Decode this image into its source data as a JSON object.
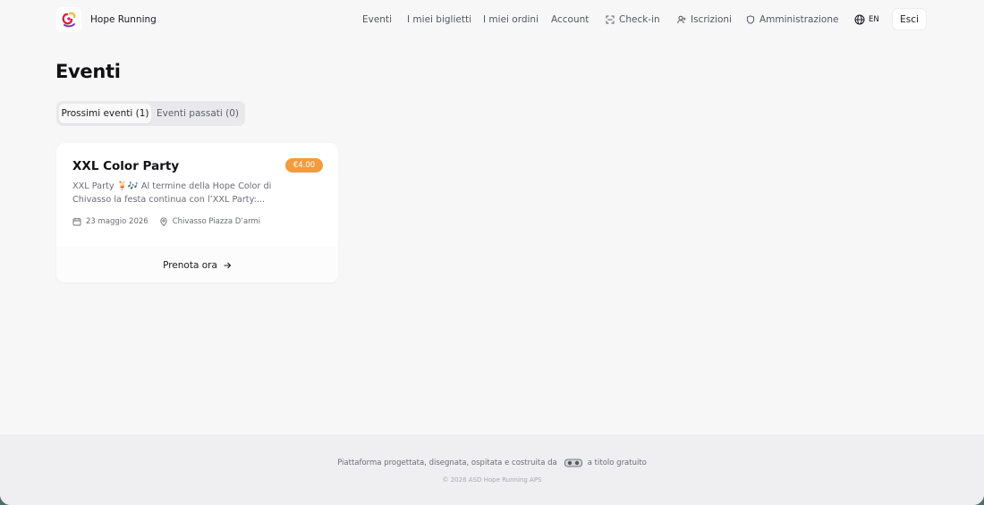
{
  "brand": {
    "name": "Hope Running"
  },
  "nav": {
    "items": [
      {
        "label": "Eventi",
        "icon": ""
      },
      {
        "label": "I miei biglietti",
        "icon": ""
      },
      {
        "label": "I miei ordini",
        "icon": ""
      },
      {
        "label": "Account",
        "icon": ""
      },
      {
        "label": "Check-in",
        "icon": "scan-icon"
      },
      {
        "label": "Iscrizioni",
        "icon": "user-plus-icon"
      },
      {
        "label": "Amministrazione",
        "icon": "shield-icon"
      }
    ],
    "language": "EN",
    "logout_label": "Esci"
  },
  "page": {
    "title": "Eventi"
  },
  "tabs": [
    {
      "label": "Prossimi eventi (1)",
      "active": true
    },
    {
      "label": "Eventi passati (0)",
      "active": false
    }
  ],
  "events": [
    {
      "title": "XXL Color Party",
      "price": "€4.00",
      "description": "XXL Party 🍹🎶 Al termine della Hope Color di Chivasso la festa continua con l’XXL Party:...",
      "date": "23 maggio 2026",
      "location": "Chivasso Piazza D’armi",
      "cta": "Prenota ora"
    }
  ],
  "footer": {
    "text_before": "Piattaforma progettata, disegnata, ospitata e costruita da",
    "text_after": "a titolo gratuito",
    "copyright": "© 2026 ASD Hope Running APS"
  },
  "colors": {
    "background": "#f7f7f8",
    "price_badge": "#f29b3f",
    "text_primary": "#111114",
    "text_muted": "#6b6d74"
  }
}
